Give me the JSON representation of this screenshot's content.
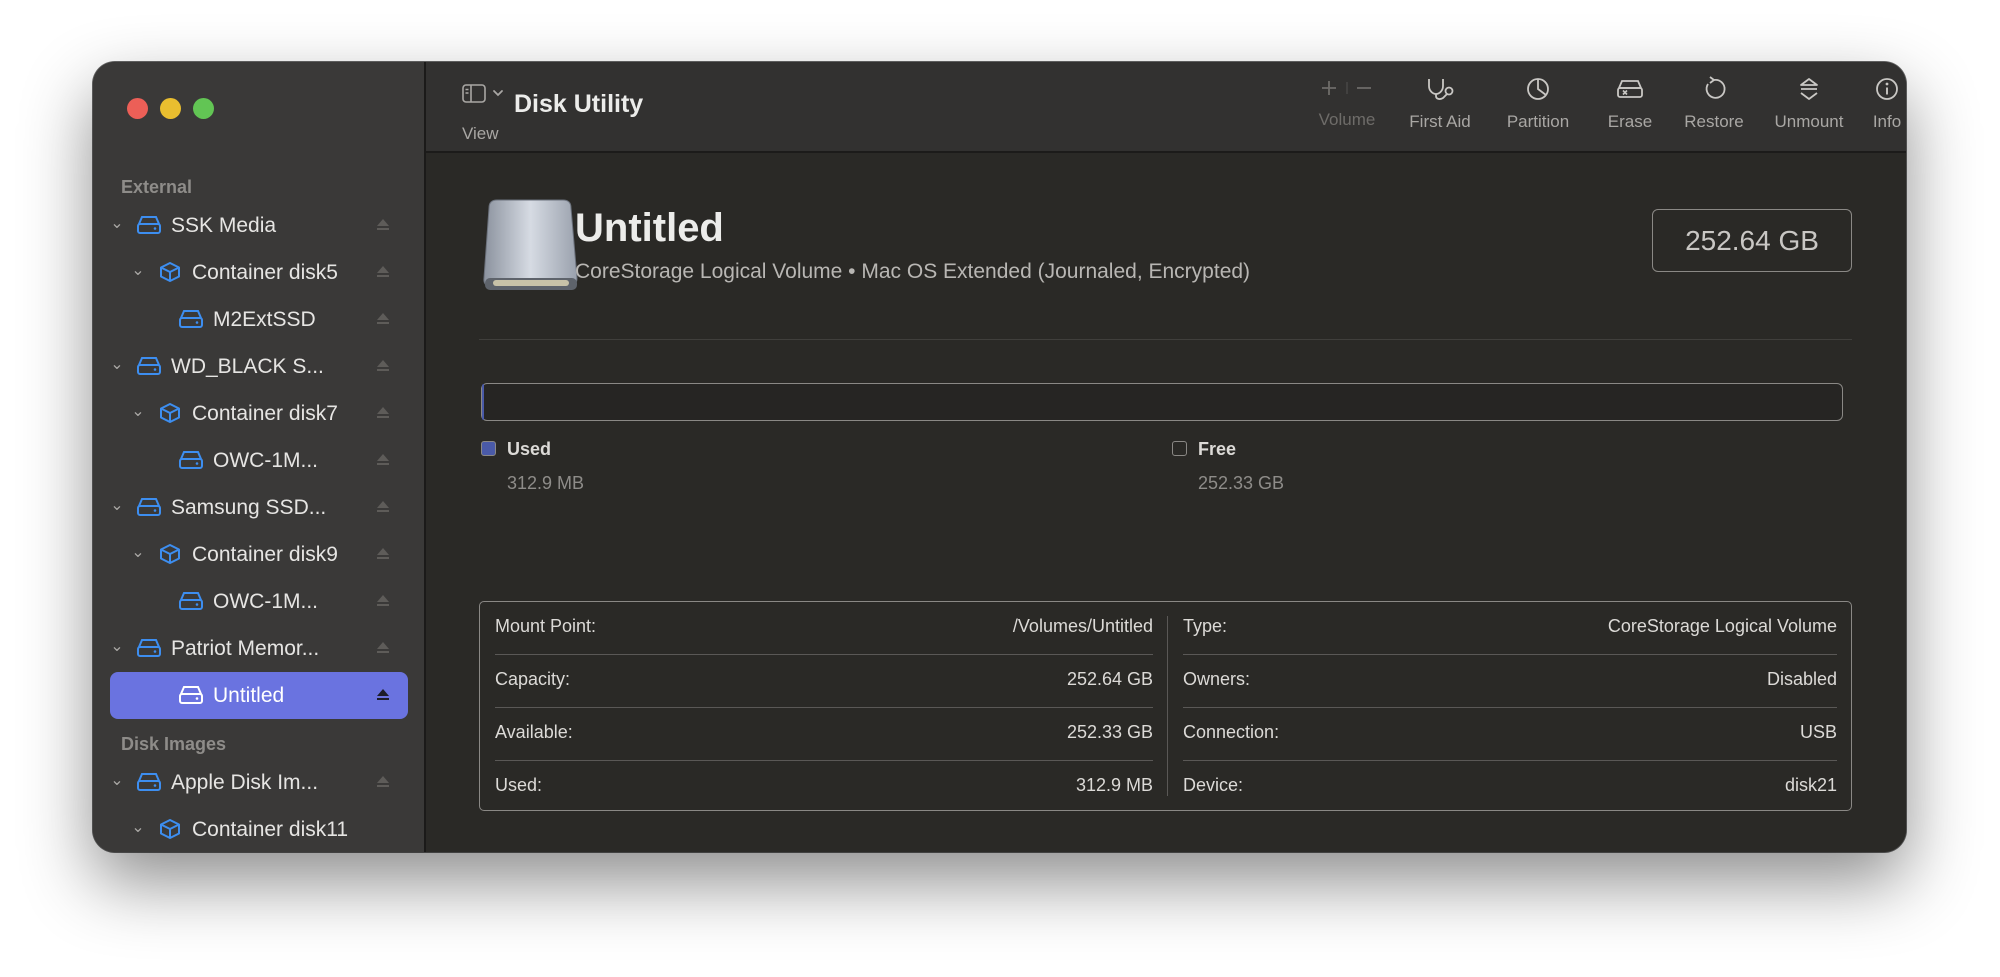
{
  "window": {
    "title": "Disk Utility"
  },
  "toolbar": {
    "view_label": "View",
    "title": "Disk Utility",
    "volume_label": "Volume",
    "first_aid_label": "First Aid",
    "partition_label": "Partition",
    "erase_label": "Erase",
    "restore_label": "Restore",
    "unmount_label": "Unmount",
    "info_label": "Info"
  },
  "sidebar": {
    "external_label": "External",
    "disk_images_label": "Disk Images",
    "items": [
      {
        "label": "SSK Media",
        "icon": "external-drive-icon"
      },
      {
        "label": "Container disk5",
        "icon": "container-icon"
      },
      {
        "label": "M2ExtSSD",
        "icon": "volume-icon"
      },
      {
        "label": "WD_BLACK S...",
        "icon": "external-drive-icon"
      },
      {
        "label": "Container disk7",
        "icon": "container-icon"
      },
      {
        "label": "OWC-1M...",
        "icon": "volume-icon"
      },
      {
        "label": "Samsung SSD...",
        "icon": "external-drive-icon"
      },
      {
        "label": "Container disk9",
        "icon": "container-icon"
      },
      {
        "label": "OWC-1M...",
        "icon": "volume-icon"
      },
      {
        "label": "Patriot Memor...",
        "icon": "external-drive-icon"
      },
      {
        "label": "Untitled",
        "icon": "volume-icon",
        "selected": true
      },
      {
        "label": "Apple Disk Im...",
        "icon": "external-drive-icon"
      },
      {
        "label": "Container disk11",
        "icon": "container-icon"
      }
    ]
  },
  "volume": {
    "name": "Untitled",
    "subtitle": "CoreStorage Logical Volume • Mac OS Extended (Journaled, Encrypted)",
    "capacity": "252.64 GB"
  },
  "usage": {
    "used_fraction": 0.0012,
    "used_label": "Used",
    "used_value": "312.9 MB",
    "free_label": "Free",
    "free_value": "252.33 GB",
    "used_color": "#4a5aa8"
  },
  "info": {
    "left": [
      {
        "key": "Mount Point:",
        "value": "/Volumes/Untitled"
      },
      {
        "key": "Capacity:",
        "value": "252.64 GB"
      },
      {
        "key": "Available:",
        "value": "252.33 GB"
      },
      {
        "key": "Used:",
        "value": "312.9 MB"
      }
    ],
    "right": [
      {
        "key": "Type:",
        "value": "CoreStorage Logical Volume"
      },
      {
        "key": "Owners:",
        "value": "Disabled"
      },
      {
        "key": "Connection:",
        "value": "USB"
      },
      {
        "key": "Device:",
        "value": "disk21"
      }
    ]
  },
  "colors": {
    "accent": "#6a73e0",
    "sidebar_icon": "#3d8ef0"
  }
}
